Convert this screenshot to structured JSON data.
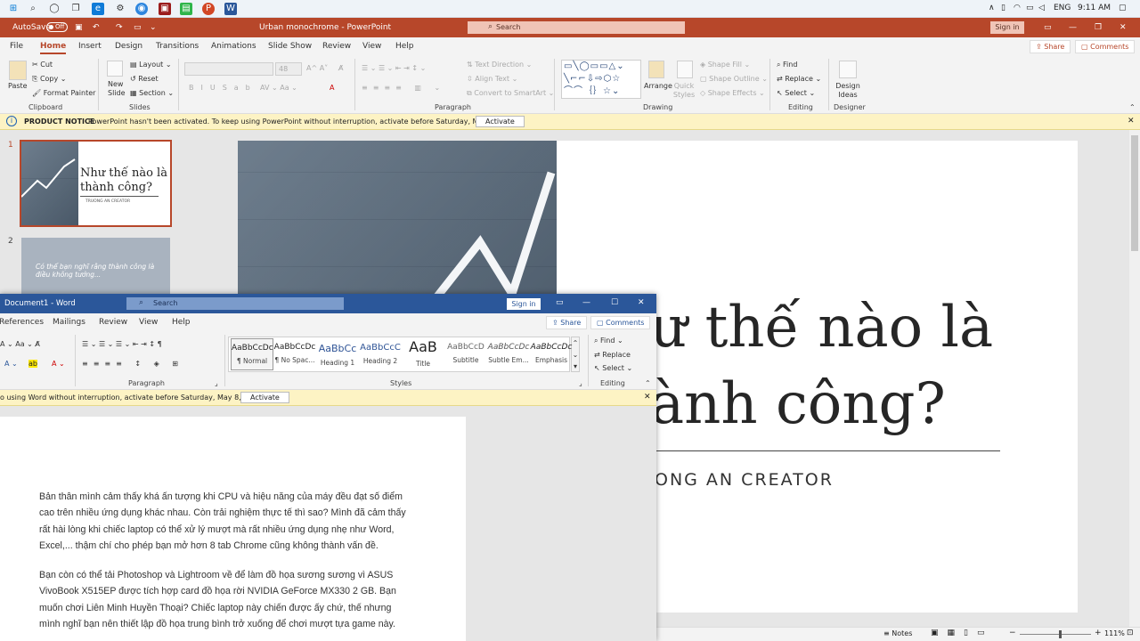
{
  "taskbar": {
    "tray": {
      "lang": "ENG",
      "time": "9:11 AM"
    }
  },
  "powerpoint": {
    "autosave_label": "AutoSave",
    "autosave_state": "Off",
    "title": "Urban monochrome  -  PowerPoint",
    "search_placeholder": "Search",
    "signin": "Sign in",
    "menu": [
      "File",
      "Home",
      "Insert",
      "Design",
      "Transitions",
      "Animations",
      "Slide Show",
      "Review",
      "View",
      "Help"
    ],
    "share": "Share",
    "comments": "Comments",
    "ribbon": {
      "paste": "Paste",
      "cut": "Cut",
      "copy": "Copy",
      "format_painter": "Format Painter",
      "clipboard": "Clipboard",
      "new_slide": "New Slide",
      "layout": "Layout",
      "reset": "Reset",
      "section": "Section",
      "slides": "Slides",
      "font_size": "48",
      "text_direction": "Text Direction",
      "align_text": "Align Text",
      "convert_smartart": "Convert to SmartArt",
      "paragraph": "Paragraph",
      "arrange": "Arrange",
      "quick_styles": "Quick Styles",
      "shape_fill": "Shape Fill",
      "shape_outline": "Shape Outline",
      "shape_effects": "Shape Effects",
      "drawing": "Drawing",
      "find": "Find",
      "replace": "Replace",
      "select": "Select",
      "editing": "Editing",
      "design_ideas": "Design Ideas",
      "designer": "Designer"
    },
    "notice": {
      "label": "PRODUCT NOTICE",
      "text": "PowerPoint hasn't been activated. To keep using PowerPoint without interruption, activate before Saturday, May 8, 2021.",
      "button": "Activate"
    },
    "thumbnails": [
      {
        "num": "1",
        "title": "Như thế nào là thành công?",
        "sub": "TRUONG AN CREATOR"
      },
      {
        "num": "2",
        "text": "Có thể bạn nghĩ rằng thành công là điều không tưởng..."
      }
    ],
    "slide": {
      "title": "ư thế nào là\nành công?",
      "subtitle": "ONG AN CREATOR"
    },
    "status": {
      "notes": "Notes",
      "zoom": "111%"
    }
  },
  "word": {
    "title": "Document1  -  Word",
    "search_placeholder": "Search",
    "signin": "Sign in",
    "menu": [
      "References",
      "Mailings",
      "Review",
      "View",
      "Help"
    ],
    "share": "Share",
    "comments": "Comments",
    "styles": [
      {
        "sample": "AaBbCcDc",
        "name": "¶ Normal"
      },
      {
        "sample": "AaBbCcDc",
        "name": "¶ No Spac..."
      },
      {
        "sample": "AaBbCc",
        "name": "Heading 1"
      },
      {
        "sample": "AaBbCcC",
        "name": "Heading 2"
      },
      {
        "sample": "AaB",
        "name": "Title"
      },
      {
        "sample": "AaBbCcD",
        "name": "Subtitle"
      },
      {
        "sample": "AaBbCcDc",
        "name": "Subtle Em..."
      },
      {
        "sample": "AaBbCcDc",
        "name": "Emphasis"
      }
    ],
    "groups": {
      "paragraph": "Paragraph",
      "styles": "Styles",
      "editing": "Editing"
    },
    "find": "Find",
    "replace": "Replace",
    "select": "Select",
    "notice": {
      "text": "o using Word without interruption, activate before Saturday, May 8, 2021.",
      "button": "Activate"
    },
    "paragraphs": [
      "Bản thân mình cảm thấy khá ấn tượng khi CPU và hiệu năng của máy đều đạt số điểm cao trên nhiều ứng dụng khác nhau. Còn trải nghiệm thực tế thì sao? Mình đã cảm thấy rất hài lòng khi chiếc laptop có thể xử lý mượt mà rất nhiều ứng dụng nhẹ như Word, Excel,... thậm chí cho phép bạn mở hơn 8 tab Chrome cũng không thành vấn đề.",
      "Bạn còn có thể tải Photoshop và Lightroom về để làm đồ họa sương sương vì ASUS VivoBook X515EP được tích hợp card đồ họa rời NVIDIA GeForce MX330 2 GB. Bạn muốn chơi Liên Minh Huyền Thoại? Chiếc laptop này chiến được ấy chứ, thế nhưng mình nghĩ bạn nên thiết lập đồ họa trung bình trở xuống để chơi mượt tựa game này."
    ]
  }
}
